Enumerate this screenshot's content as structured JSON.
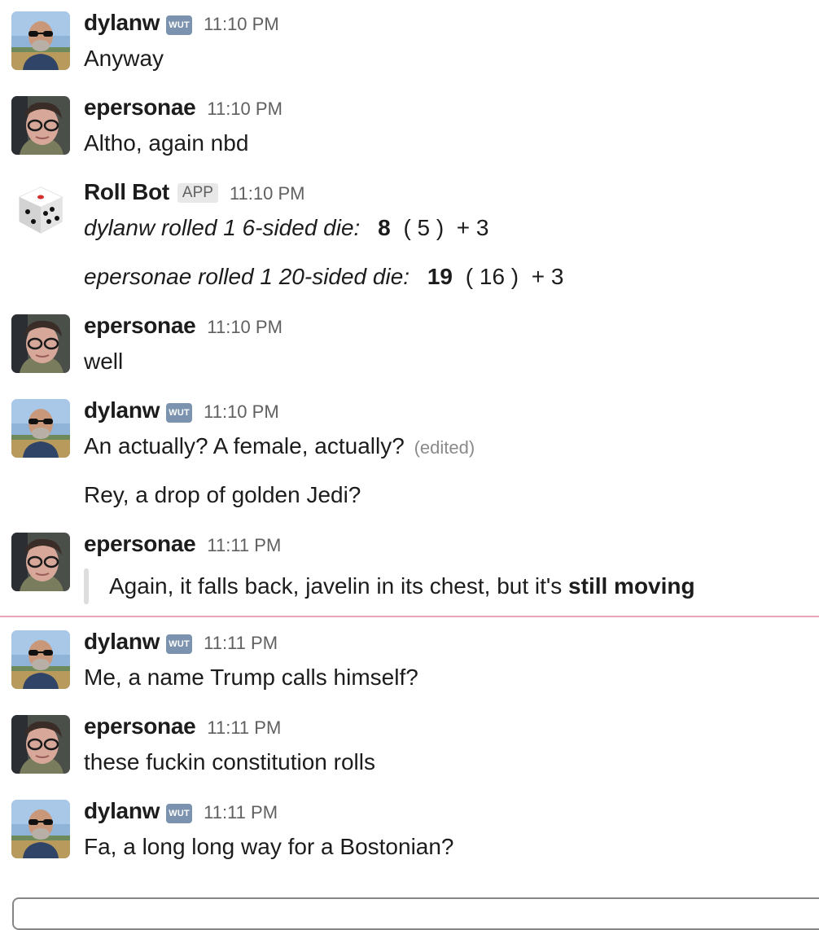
{
  "messages": [
    {
      "user": "dylanw",
      "badge": "WUT",
      "time": "11:10 PM",
      "lines": [
        "Anyway"
      ]
    },
    {
      "user": "epersonae",
      "time": "11:10 PM",
      "lines": [
        "Altho, again nbd"
      ]
    },
    {
      "user": "Roll Bot",
      "badge": "APP",
      "time": "11:10 PM",
      "rolls": [
        {
          "desc": "dylanw rolled 1 6-sided die:",
          "total": "8",
          "detail": "( 5 )  + 3"
        },
        {
          "desc": "epersonae rolled 1 20-sided die:",
          "total": "19",
          "detail": "( 16 )  + 3"
        }
      ]
    },
    {
      "user": "epersonae",
      "time": "11:10 PM",
      "lines": [
        "well"
      ]
    },
    {
      "user": "dylanw",
      "badge": "WUT",
      "time": "11:10 PM",
      "lines": [
        "An actually? A female, actually?",
        "Rey, a drop of golden Jedi?"
      ],
      "edited": "(edited)"
    },
    {
      "user": "epersonae",
      "time": "11:11 PM",
      "quote": {
        "text": "Again, it falls back, javelin in its chest, but it's ",
        "bold": "still moving"
      }
    },
    {
      "user": "dylanw",
      "badge": "WUT",
      "time": "11:11 PM",
      "lines": [
        "Me, a name Trump calls himself?"
      ]
    },
    {
      "user": "epersonae",
      "time": "11:11 PM",
      "lines": [
        "these fuckin constitution rolls"
      ]
    },
    {
      "user": "dylanw",
      "badge": "WUT",
      "time": "11:11 PM",
      "lines": [
        "Fa, a long long way for a Bostonian?"
      ]
    }
  ],
  "colors": {
    "new_message_divider": "#e9a5b7",
    "wut_badge": "#7c93b0"
  }
}
